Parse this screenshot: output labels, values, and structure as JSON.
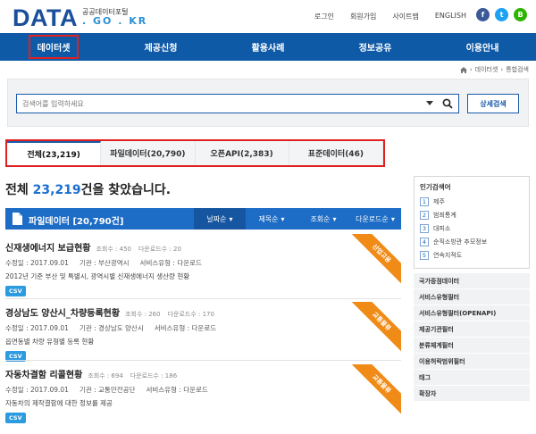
{
  "header": {
    "logo_main": "DATA",
    "logo_sub": "공공데이터포털",
    "logo_domain": ". GO . KR",
    "links": [
      "로그인",
      "회원가입",
      "사이트맵",
      "ENGLISH"
    ],
    "social": [
      {
        "icon": "facebook-icon",
        "glyph": "f",
        "color": "#3b5998"
      },
      {
        "icon": "twitter-icon",
        "glyph": "t",
        "color": "#1da1f2"
      },
      {
        "icon": "blog-icon",
        "glyph": "B",
        "color": "#2db400"
      }
    ]
  },
  "nav": {
    "items": [
      "데이터셋",
      "제공신청",
      "활용사례",
      "정보공유",
      "이용안내"
    ],
    "selected": 0
  },
  "breadcrumb": [
    "데이터셋",
    "통합검색"
  ],
  "search": {
    "placeholder": "검색어를 입력하세요",
    "advanced_label": "상세검색"
  },
  "tabs": {
    "items": [
      "전체(23,219)",
      "파일데이터(20,790)",
      "오픈API(2,383)",
      "표준데이터(46)"
    ],
    "active": 0
  },
  "results_summary": {
    "prefix": "전체",
    "count": "23,219",
    "suffix": "건을 찾았습니다."
  },
  "file_section": {
    "title": "파일데이터 [20,790건]",
    "sort_options": [
      "날짜순",
      "제목순",
      "조회순",
      "다운로드순"
    ],
    "active_sort": 0
  },
  "items": [
    {
      "title": "신재생에너지 보급현황",
      "views": "조회수 : 450",
      "downloads": "다운로드수 : 20",
      "modified": "수정일 : 2017.09.01",
      "org": "기관 : 부산광역시",
      "service": "서비스유형 : 다운로드",
      "desc": "2012년 기준 부산 및 특별시, 광역시별 신재생에너지 생산량 현황",
      "format": "CSV",
      "ribbon": "산업고용"
    },
    {
      "title": "경상남도 양산시_차량등록현황",
      "views": "조회수 : 260",
      "downloads": "다운로드수 : 170",
      "modified": "수정일 : 2017.09.01",
      "org": "기관 : 경상남도 양산시",
      "service": "서비스유형 : 다운로드",
      "desc": "읍면동별 차량 유형별 등록 현황",
      "format": "CSV",
      "ribbon": "교통물류"
    },
    {
      "title": "자동차결함 리콜현황",
      "views": "조회수 : 694",
      "downloads": "다운로드수 : 186",
      "modified": "수정일 : 2017.09.01",
      "org": "기관 : 교통안전공단",
      "service": "서비스유형 : 다운로드",
      "desc": "자동차의 제작결함에 대한 정보를 제공",
      "format": "CSV",
      "ribbon": "교통물류"
    }
  ],
  "sidebar": {
    "popular_title": "인기검색어",
    "popular": [
      "제주",
      "범죄통계",
      "대피소",
      "순직소방관 추모정보",
      "연속지적도"
    ],
    "links": [
      "국가중점데이터",
      "서비스유형필터",
      "서비스유형필터(OPENAPI)",
      "제공기관필터",
      "분류체계필터",
      "이용허락범위필터",
      "태그",
      "확장자"
    ]
  },
  "colors": {
    "brand": "#1a4f9c",
    "nav": "#0e5aa7",
    "accent": "#1d6cc5",
    "highlight": "#e02020",
    "ribbon": "#f08b18",
    "csv_badge": "#2d9be0"
  }
}
